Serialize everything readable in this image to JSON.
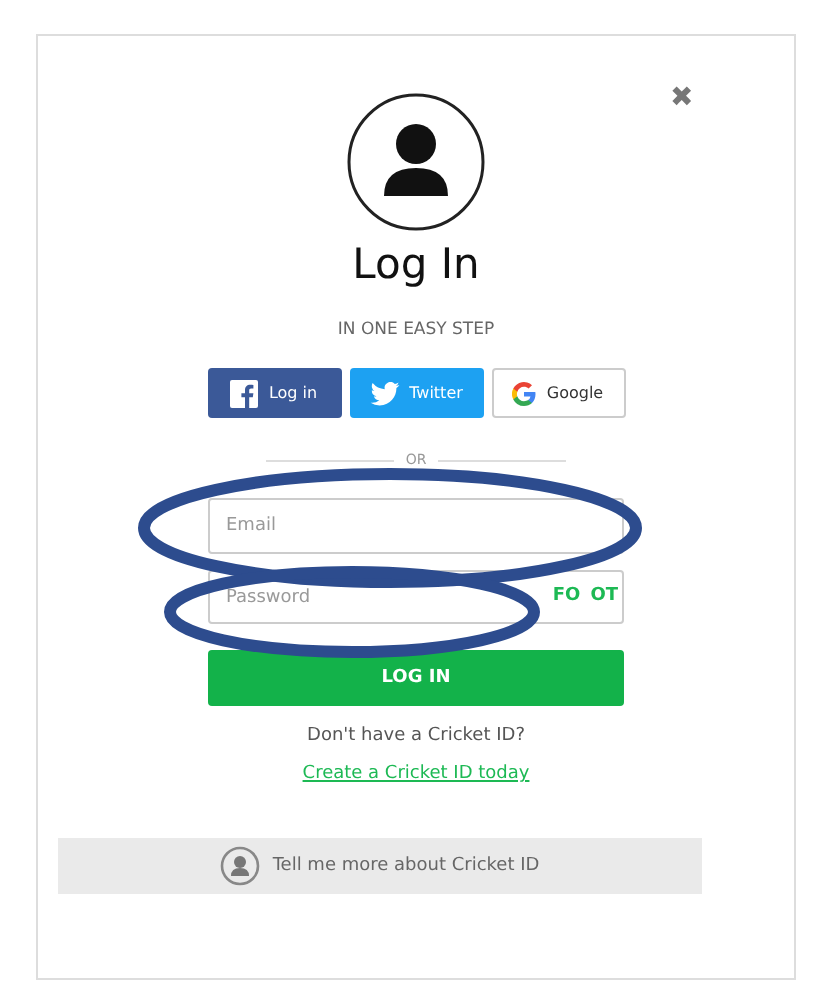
{
  "dialog": {
    "title": "Log In",
    "subtitle": "IN ONE EASY STEP",
    "close": "✖"
  },
  "social_buttons": [
    {
      "kind": "facebook",
      "label": "Log in"
    },
    {
      "kind": "twitter",
      "label": "Twitter"
    },
    {
      "kind": "google",
      "label": "Google"
    }
  ],
  "divider": "OR",
  "email_field": {
    "placeholder": "Email"
  },
  "password_field": {
    "placeholder": "Password",
    "action_parts": [
      "FO",
      "OT"
    ]
  },
  "login_button": "LOG IN",
  "signup_prompt": "Don't have a Cricket ID?",
  "signup_link": "Create a Cricket ID today",
  "info_bar": "Tell me more about Cricket ID"
}
